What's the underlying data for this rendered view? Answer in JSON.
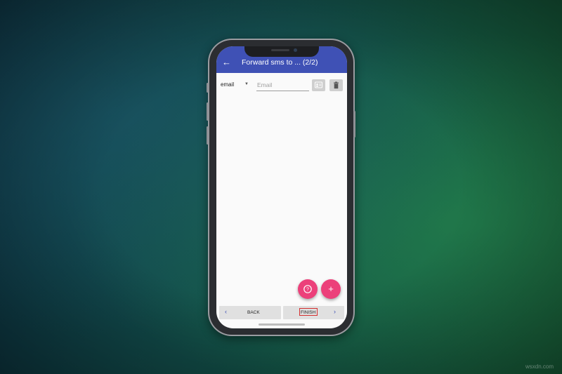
{
  "colors": {
    "appbar": "#3f51b5",
    "fab": "#ec407a",
    "finish_highlight": "#d32f2f"
  },
  "appbar": {
    "back_icon": "arrow-left-icon",
    "title": "Forward sms to ... (2/2)"
  },
  "recipient_row": {
    "type_value": "email",
    "email_placeholder": "Email",
    "contact_icon": "contact-card-icon",
    "delete_icon": "trash-icon"
  },
  "fabs": {
    "help_icon": "help-circle-icon",
    "add_icon": "plus-icon"
  },
  "bottom_bar": {
    "back_label": "BACK",
    "finish_label": "FINISH"
  },
  "watermark": "wsxdn.com"
}
